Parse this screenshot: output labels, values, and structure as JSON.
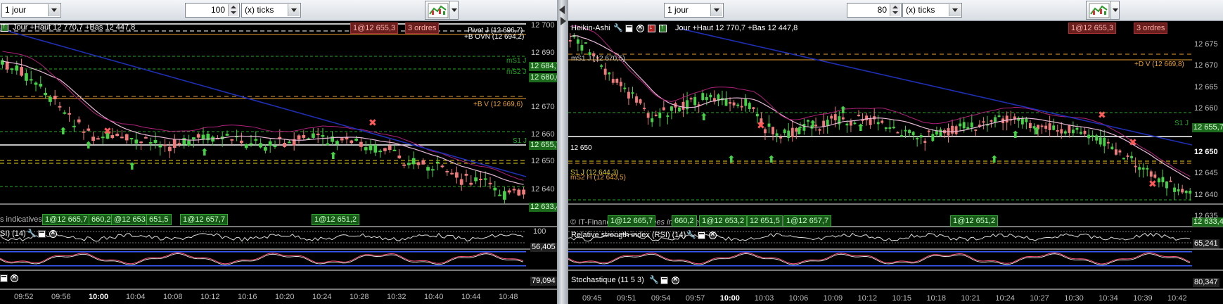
{
  "left": {
    "toolbar": {
      "period": "1 jour",
      "units": "100",
      "unit_type": "(x) ticks"
    },
    "header_text": "Jour +Haut 12 770,7 +Bas 12 447,8",
    "levels": {
      "pivot": "Pivot J (12 696,7)",
      "ovn": "+B OVN (12 694,2)",
      "ms1": "mS1 J",
      "ms2": "mS2 J",
      "bv": "+B V (12 669,6)",
      "s1": "S1 J"
    },
    "order_tags": [
      "1@12 655,3",
      "3 ordres"
    ],
    "buy_tags": [
      "1@12 665,7",
      "660,2",
      "@12 653,2",
      "651,5",
      "1@12 657,7",
      "1@12 651,2"
    ],
    "price_boxes": [
      "12 684,7",
      "12 680,6",
      "12 655,7",
      "12 633,4"
    ],
    "axis": [
      "12 700",
      "12 690",
      "12 680",
      "12 670",
      "12 660",
      "12 650",
      "12 640"
    ],
    "watermark": "s indicatives",
    "rsi_label": "SI) (14)",
    "rsi_value": "56,405",
    "stoch_value": "79,094",
    "units_axis": "100",
    "times": [
      "09:52",
      "09:56",
      "10:00",
      "10:04",
      "10:08",
      "10:12",
      "10:16",
      "10:20",
      "10:24",
      "10:28",
      "10:32",
      "10:40",
      "10:44",
      "10:48"
    ]
  },
  "right": {
    "toolbar": {
      "period": "1 jour",
      "units": "80",
      "unit_type": "(x) ticks"
    },
    "chart_label": "Heikin-Ashi",
    "header_text": "Jour +Haut 12 770,7 +Bas 12 447,8",
    "levels": {
      "ms1": "mS1 J (12 670,5)",
      "dv": "+D V (12 669,8)",
      "s1": "S1 J",
      "price_line": "12 650",
      "s1b": "S1 J (12 644,3)",
      "ms2h": "mS2 H (12 643,5)"
    },
    "order_tags": [
      "1@12 655,3",
      "3 ordres"
    ],
    "buy_tags": [
      "1@12 665,7",
      "660,2",
      "1@12 653,2",
      "12 651,5",
      "1@12 657,7",
      "1@12 651,2"
    ],
    "price_boxes": [
      "12 655,7",
      "12 633,4"
    ],
    "axis": [
      "12 675",
      "12 670",
      "12 665",
      "12 660",
      "12 655",
      "12 650",
      "12 645",
      "12 640",
      "12 635"
    ],
    "watermark": "© IT-Finance.com",
    "watermark2": "Données indicatives",
    "rsi_label": "Relative strength index (RSI) (14)",
    "rsi_value": "65,241",
    "stoch_label": "Stochastique (11 5 3)",
    "stoch_value": "80,347",
    "times": [
      "09:45",
      "09:51",
      "09:54",
      "09:57",
      "10:00",
      "10:03",
      "10:06",
      "10:09",
      "10:12",
      "10:15",
      "10:18",
      "10:21",
      "10:24",
      "10:27",
      "10:30",
      "10:34",
      "10:39",
      "10:42"
    ]
  },
  "colors": {
    "up": "#46d246",
    "down": "#f07a7a",
    "ma_blue": "#1f2fb5",
    "ma_pink": "#e8b8d8",
    "magenta": "#b0207a",
    "pivot": "#ffffff",
    "orange": "#e8a030",
    "dashed_green": "#22aa22",
    "yellow": "#e6d020"
  }
}
